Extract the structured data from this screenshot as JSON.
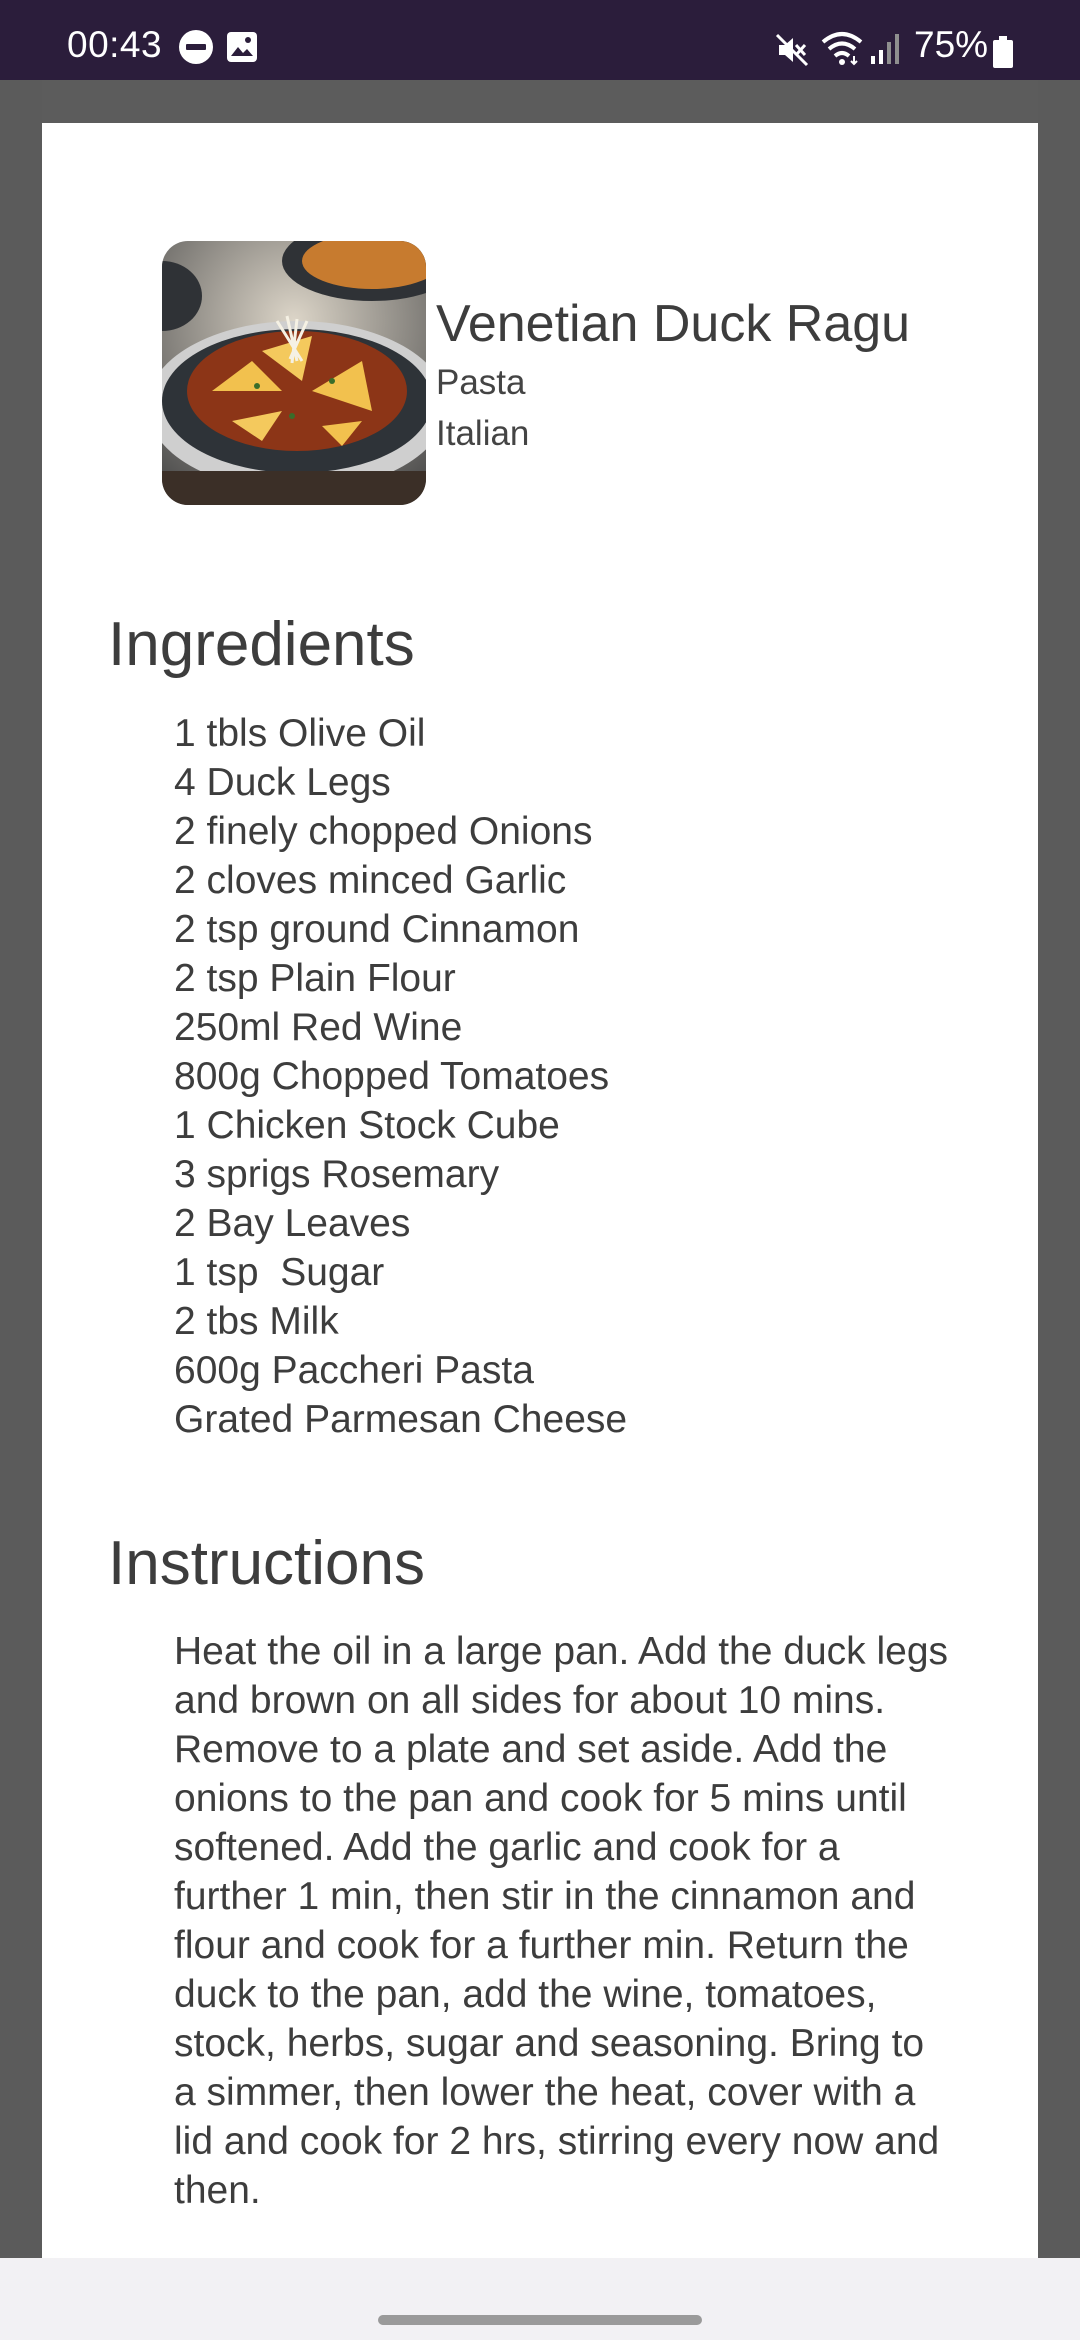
{
  "status_bar": {
    "time": "00:43",
    "battery_percent": "75%",
    "icons": [
      "do-not-disturb-icon",
      "gallery-icon",
      "mute-icon",
      "wifi-icon",
      "signal-icon",
      "battery-icon"
    ]
  },
  "recipe": {
    "title": "Venetian Duck Ragu",
    "category": "Pasta",
    "cuisine": "Italian",
    "image_icon": "duck-ragu-photo"
  },
  "ingredients": {
    "heading": "Ingredients",
    "items": [
      "1 tbls Olive Oil",
      "4 Duck Legs",
      "2 finely chopped Onions",
      "2 cloves minced Garlic",
      "2 tsp ground Cinnamon",
      "2 tsp Plain Flour",
      "250ml Red Wine",
      "800g Chopped Tomatoes",
      "1 Chicken Stock Cube",
      "3 sprigs Rosemary",
      "2 Bay Leaves",
      "1 tsp  Sugar",
      "2 tbs Milk",
      "600g Paccheri Pasta",
      "Grated Parmesan Cheese"
    ]
  },
  "instructions": {
    "heading": "Instructions",
    "text": "Heat the oil in a large pan. Add the duck legs and brown on all sides for about 10 mins. Remove to a plate and set aside. Add the onions to the pan and cook for 5 mins until softened. Add the garlic and cook for a further 1 min, then stir in the cinnamon and flour and cook for a further min. Return the duck to the pan, add the wine, tomatoes, stock, herbs, sugar and seasoning. Bring to a simmer, then lower the heat, cover with a lid and cook for 2 hrs, stirring every now and then."
  },
  "colors": {
    "status_bar": "#2b1d3b",
    "scrim": "#5b5b5b",
    "card": "#ffffff",
    "text": "#3d3d3d"
  }
}
